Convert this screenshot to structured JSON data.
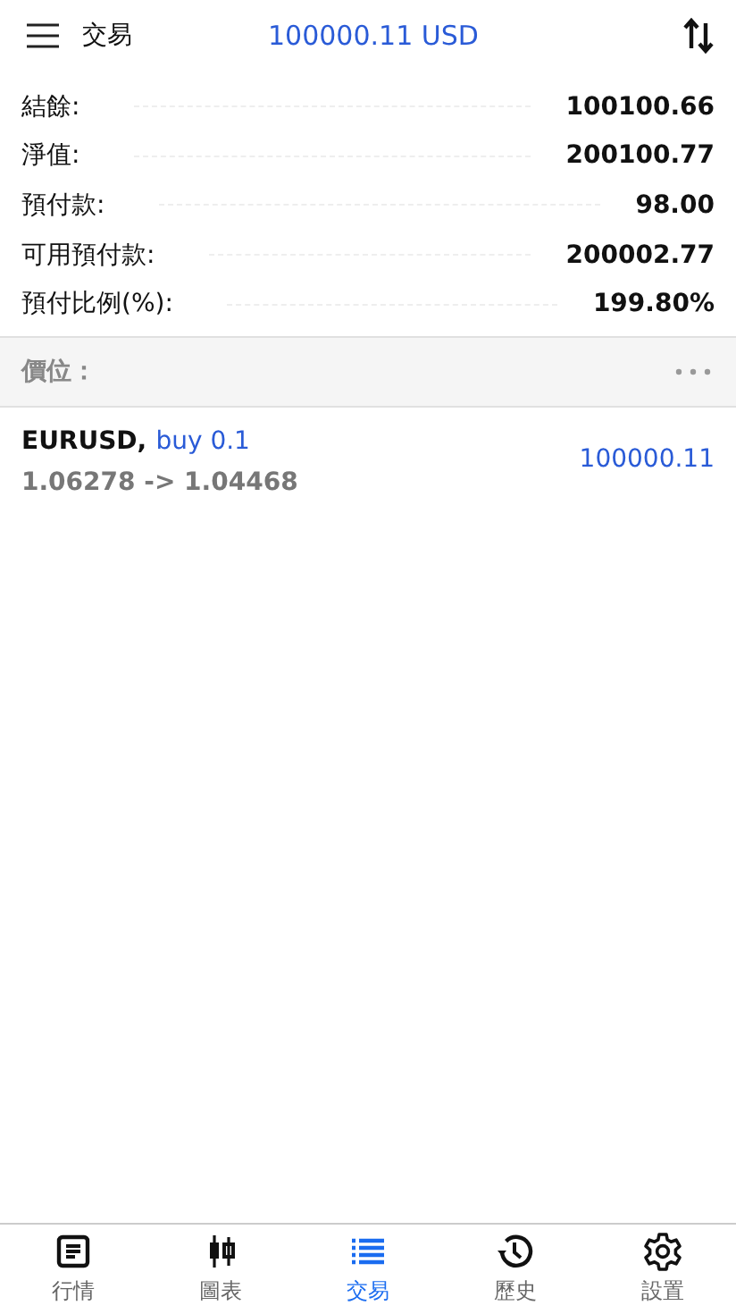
{
  "header": {
    "title": "交易",
    "balance": "100000.11 USD"
  },
  "summary": [
    {
      "label": "結餘:",
      "value": "100100.66"
    },
    {
      "label": "淨值:",
      "value": "200100.77"
    },
    {
      "label": "預付款:",
      "value": "98.00"
    },
    {
      "label": "可用預付款:",
      "value": "200002.77"
    },
    {
      "label": "預付比例(%):",
      "value": "199.80%"
    }
  ],
  "positions_header": {
    "title": "價位："
  },
  "positions": [
    {
      "symbol": "EURUSD,",
      "order": "buy 0.1",
      "prices": "1.06278 -> 1.04468",
      "profit": "100000.11"
    }
  ],
  "tabs": [
    {
      "label": "行情",
      "selected": false
    },
    {
      "label": "圖表",
      "selected": false
    },
    {
      "label": "交易",
      "selected": true
    },
    {
      "label": "歷史",
      "selected": false
    },
    {
      "label": "設置",
      "selected": false
    }
  ]
}
